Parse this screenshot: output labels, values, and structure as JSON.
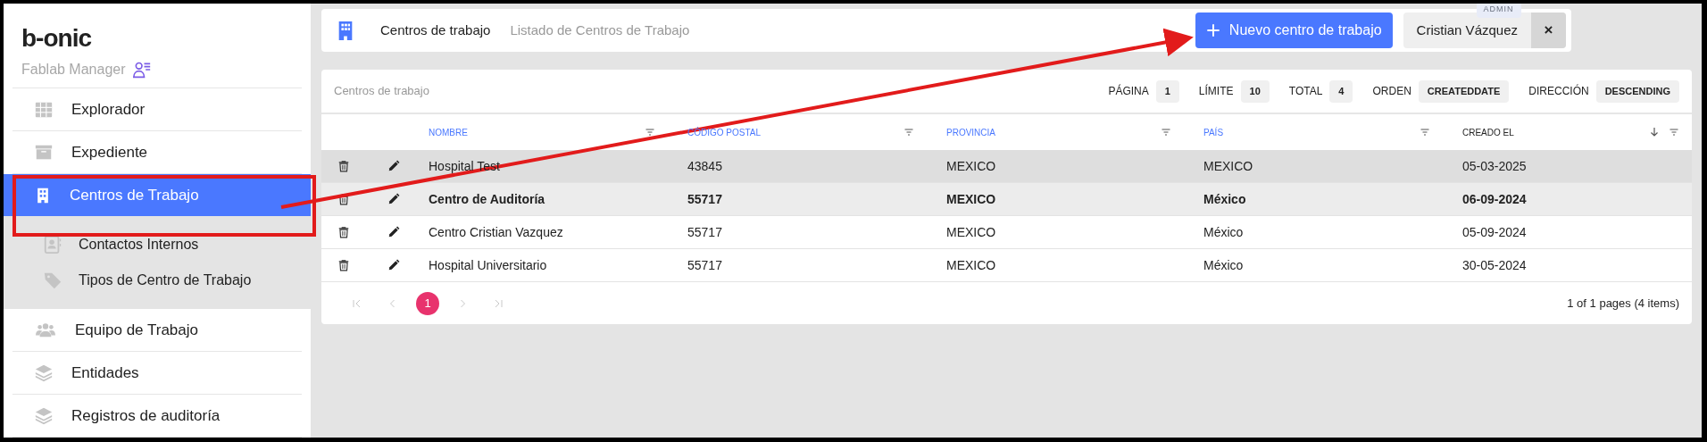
{
  "brand": {
    "logo": "b-onic",
    "subtitle": "Fablab Manager"
  },
  "sidebar": {
    "items": [
      {
        "label": "Explorador",
        "selected": false
      },
      {
        "label": "Expediente",
        "selected": false
      },
      {
        "label": "Centros de Trabajo",
        "selected": true,
        "expanded": true,
        "children": [
          {
            "label": "Contactos Internos"
          },
          {
            "label": "Tipos de Centro de Trabajo"
          }
        ]
      },
      {
        "label": "Equipo de Trabajo",
        "selected": false
      },
      {
        "label": "Entidades",
        "selected": false
      },
      {
        "label": "Registros de auditoría",
        "selected": false
      }
    ]
  },
  "header": {
    "title": "Centros de trabajo",
    "subtitle": "Listado de Centros de Trabajo",
    "new_button": "Nuevo centro de trabajo",
    "user": {
      "name": "Cristian Vázquez",
      "role": "ADMIN",
      "close": "×"
    }
  },
  "table": {
    "title": "Centros de trabajo",
    "meta": [
      {
        "label": "PÁGINA",
        "value": "1"
      },
      {
        "label": "LÍMITE",
        "value": "10"
      },
      {
        "label": "TOTAL",
        "value": "4"
      },
      {
        "label": "ORDEN",
        "value": "CREATEDDATE"
      },
      {
        "label": "DIRECCIÓN",
        "value": "DESCENDING"
      }
    ],
    "columns": [
      {
        "label": "NOMBRE",
        "sorted": false
      },
      {
        "label": "CÓDIGO POSTAL",
        "sorted": false
      },
      {
        "label": "PROVINCIA",
        "sorted": false
      },
      {
        "label": "PAÍS",
        "sorted": false
      },
      {
        "label": "CREADO EL",
        "sorted": true
      }
    ],
    "rows": [
      {
        "cells": [
          "Hospital Test",
          "43845",
          "MEXICO",
          "MEXICO",
          "05-03-2025"
        ],
        "hovered": true,
        "selected": false
      },
      {
        "cells": [
          "Centro de Auditoría",
          "55717",
          "MEXICO",
          "México",
          "06-09-2024"
        ],
        "hovered": false,
        "selected": true
      },
      {
        "cells": [
          "Centro Cristian Vazquez",
          "55717",
          "MEXICO",
          "México",
          "05-09-2024"
        ],
        "hovered": false,
        "selected": false
      },
      {
        "cells": [
          "Hospital Universitario",
          "55717",
          "MEXICO",
          "México",
          "30-05-2024"
        ],
        "hovered": false,
        "selected": false
      }
    ],
    "pagination": {
      "pages": [
        {
          "label": "1",
          "selected": true
        }
      ],
      "summary": "1 of 1 pages (4 items)"
    }
  },
  "annotations": {
    "highlight_frame": true,
    "arrow": true
  }
}
